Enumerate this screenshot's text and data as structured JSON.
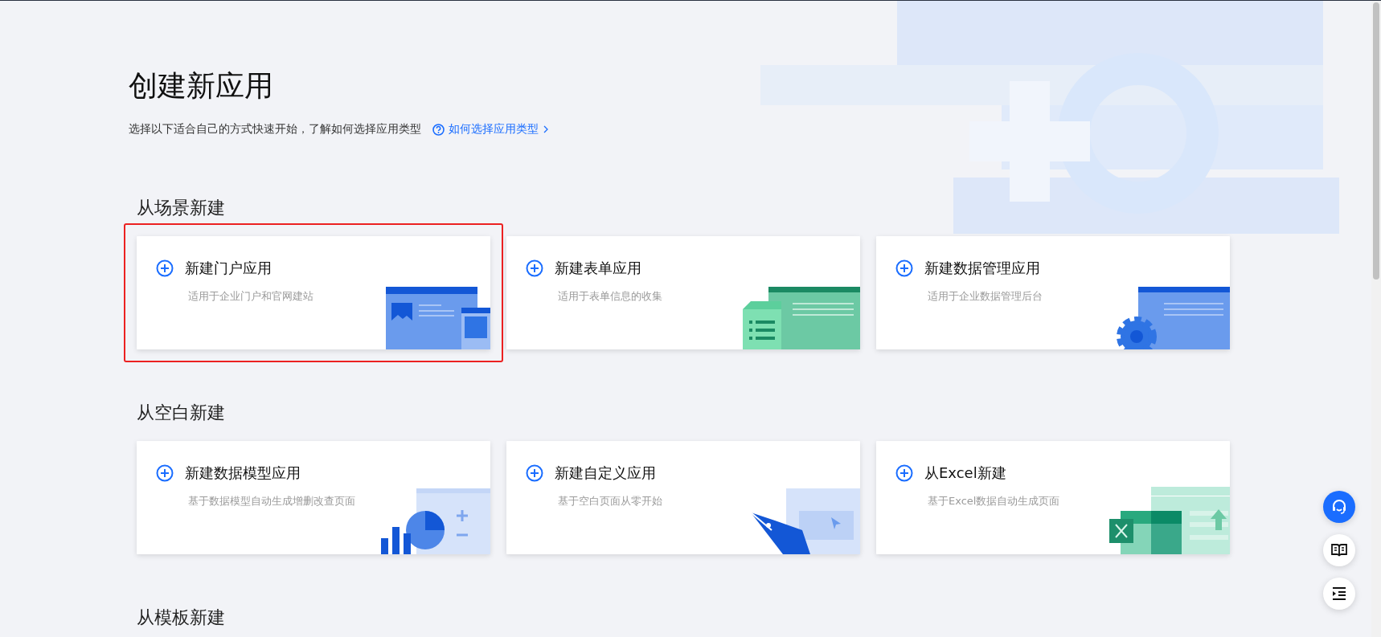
{
  "page": {
    "title": "创建新应用",
    "subtitle": "选择以下适合自己的方式快速开始，了解如何选择应用类型",
    "help_link": "如何选择应用类型"
  },
  "sections": [
    {
      "title": "从场景新建",
      "cards": [
        {
          "kind": "portal",
          "title": "新建门户应用",
          "description": "适用于企业门户和官网建站",
          "highlighted": true
        },
        {
          "kind": "form",
          "title": "新建表单应用",
          "description": "适用于表单信息的收集",
          "highlighted": false
        },
        {
          "kind": "data",
          "title": "新建数据管理应用",
          "description": "适用于企业数据管理后台",
          "highlighted": false
        }
      ]
    },
    {
      "title": "从空白新建",
      "cards": [
        {
          "kind": "model",
          "title": "新建数据模型应用",
          "description": "基于数据模型自动生成增删改查页面",
          "highlighted": false
        },
        {
          "kind": "custom",
          "title": "新建自定义应用",
          "description": "基于空白页面从零开始",
          "highlighted": false
        },
        {
          "kind": "excel",
          "title": "从Excel新建",
          "description": "基于Excel数据自动生成页面",
          "highlighted": false
        }
      ]
    },
    {
      "title": "从模板新建"
    }
  ],
  "floating_buttons": [
    {
      "kind": "support"
    },
    {
      "kind": "docs"
    },
    {
      "kind": "outline"
    }
  ]
}
